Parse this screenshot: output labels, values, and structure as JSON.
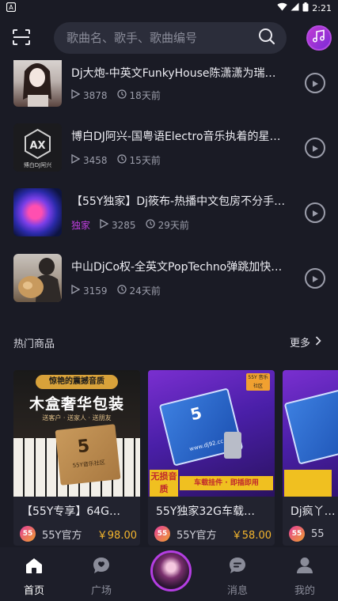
{
  "status_bar": {
    "left_icon": "a-notification-icon",
    "time": "2:21"
  },
  "search": {
    "placeholder": "歌曲名、歌手、歌曲编号"
  },
  "tracks": [
    {
      "title": "Dj大炮-中英文FunkyHouse陈潇潇为瑞姐抖…",
      "plays": "3878",
      "age": "18天前",
      "tag": ""
    },
    {
      "title": "博白DJ阿兴-国粤语Electro音乐执着的星语…",
      "plays": "3458",
      "age": "15天前",
      "tag": ""
    },
    {
      "title": "【55Y独家】Dj筱布-热播中文包房不分手的…",
      "plays": "3285",
      "age": "29天前",
      "tag": "独家"
    },
    {
      "title": "中山DjCo权-全英文PopTechno弹跳加快版…",
      "plays": "3159",
      "age": "24天前",
      "tag": ""
    }
  ],
  "covers": {
    "cover2_text": "博白DJ阿兴"
  },
  "hot_goods": {
    "title": "热门商品",
    "more": "更多",
    "items": [
      {
        "title": "【55Y专享】64G…",
        "shop": "55Y官方",
        "price": "￥98.00",
        "img_banner": "惊艳的震撼音质",
        "img_headline": "木盒奢华包装",
        "img_sub": "送客户 · 送家人 · 送朋友",
        "img_brand": "55Y音乐社区"
      },
      {
        "title": "55Y独家32G车载…",
        "shop": "55Y官方",
        "price": "￥58.00",
        "img_tag": "55Y 音乐社区",
        "img_badge": "无损音质",
        "img_strip": "车载挂件 · 即插即用",
        "img_url": "www.dj92.cc"
      },
      {
        "title": "Dj疯丫…",
        "shop": "55",
        "price": ""
      }
    ]
  },
  "shop_logo_text": "55",
  "nav": {
    "home": "首页",
    "plaza": "广场",
    "messages": "消息",
    "mine": "我的"
  },
  "colors": {
    "accent": "#c03fe0",
    "price": "#f5b62d",
    "background": "#1a1b25"
  }
}
